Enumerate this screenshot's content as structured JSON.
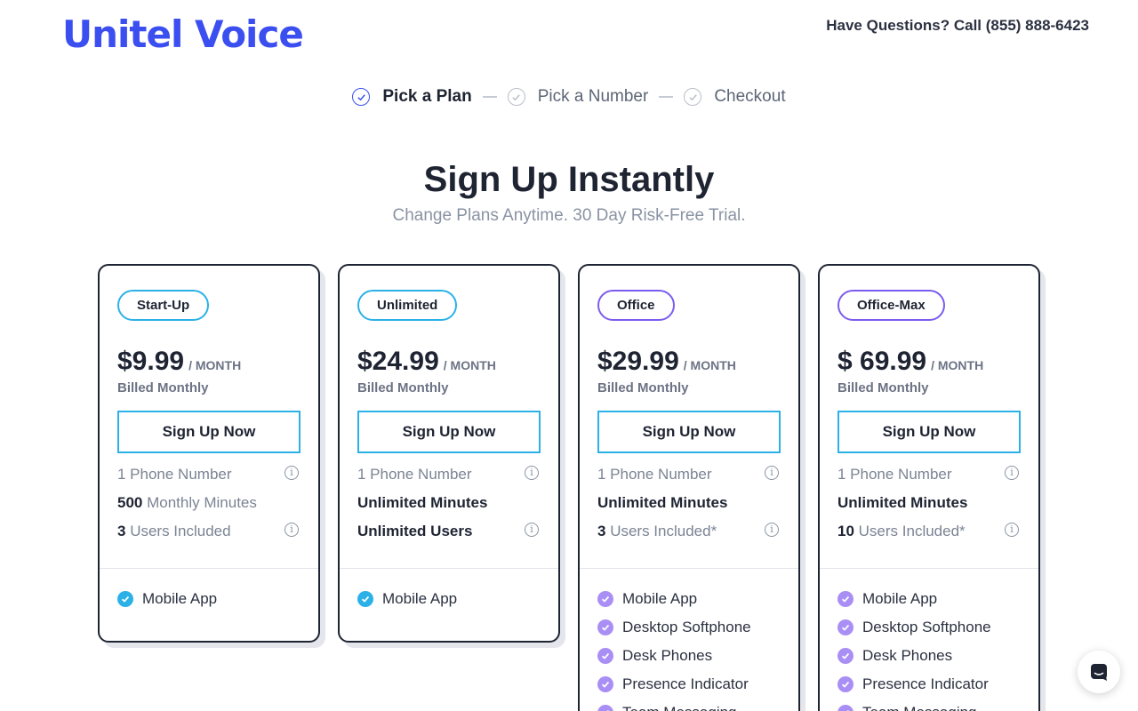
{
  "header": {
    "logo_text": "Unitel Voice",
    "phone_text": "Have Questions? Call (855) 888-6423"
  },
  "steps": [
    {
      "label": "Pick a Plan",
      "active": true
    },
    {
      "label": "Pick a Number",
      "active": false
    },
    {
      "label": "Checkout",
      "active": false
    }
  ],
  "hero": {
    "title": "Sign Up Instantly",
    "subtitle": "Change Plans Anytime. 30 Day Risk-Free Trial."
  },
  "plans": [
    {
      "name": "Start-Up",
      "price": "$9.99",
      "per": "/ MONTH",
      "billed": "Billed Monthly",
      "button": "Sign Up Now",
      "features": [
        {
          "bold": "",
          "text": "1 Phone Number",
          "info": true
        },
        {
          "bold": "500",
          "text": " Monthly Minutes",
          "info": false
        },
        {
          "bold": "3",
          "text": " Users Included",
          "info": true
        }
      ],
      "extras": [
        "Mobile App"
      ]
    },
    {
      "name": "Unlimited",
      "price": "$24.99",
      "per": "/ MONTH",
      "billed": "Billed Monthly",
      "button": "Sign Up Now",
      "features": [
        {
          "bold": "",
          "text": "1 Phone Number",
          "info": true
        },
        {
          "bold": "Unlimited Minutes",
          "text": "",
          "info": false
        },
        {
          "bold": "Unlimited Users",
          "text": "",
          "info": true
        }
      ],
      "extras": [
        "Mobile App"
      ]
    },
    {
      "name": "Office",
      "price": "$29.99",
      "per": "/ MONTH",
      "billed": "Billed Monthly",
      "button": "Sign Up Now",
      "features": [
        {
          "bold": "",
          "text": "1 Phone Number",
          "info": true
        },
        {
          "bold": "Unlimited Minutes",
          "text": "",
          "info": false
        },
        {
          "bold": "3",
          "text": " Users Included*",
          "info": true
        }
      ],
      "extras": [
        "Mobile App",
        "Desktop Softphone",
        "Desk Phones",
        "Presence Indicator",
        "Team Messaging"
      ]
    },
    {
      "name": "Office-Max",
      "price": "$ 69.99",
      "per": "/ MONTH",
      "billed": "Billed Monthly",
      "button": "Sign Up Now",
      "features": [
        {
          "bold": "",
          "text": "1 Phone Number",
          "info": true
        },
        {
          "bold": "Unlimited Minutes",
          "text": "",
          "info": false
        },
        {
          "bold": "10",
          "text": " Users Included*",
          "info": true
        }
      ],
      "extras": [
        "Mobile App",
        "Desktop Softphone",
        "Desk Phones",
        "Presence Indicator",
        "Team Messaging"
      ]
    }
  ],
  "colors": {
    "brand": "#3b4ef0",
    "cyan_accent": "#2bb1e8",
    "purple_accent": "#7b5cf0",
    "text_dark": "#1f2433",
    "text_muted": "#7b8494"
  },
  "icons": {
    "step": "check-circle-icon",
    "info": "info-icon",
    "feature_check": "check-badge-icon",
    "chat": "chat-icon"
  }
}
